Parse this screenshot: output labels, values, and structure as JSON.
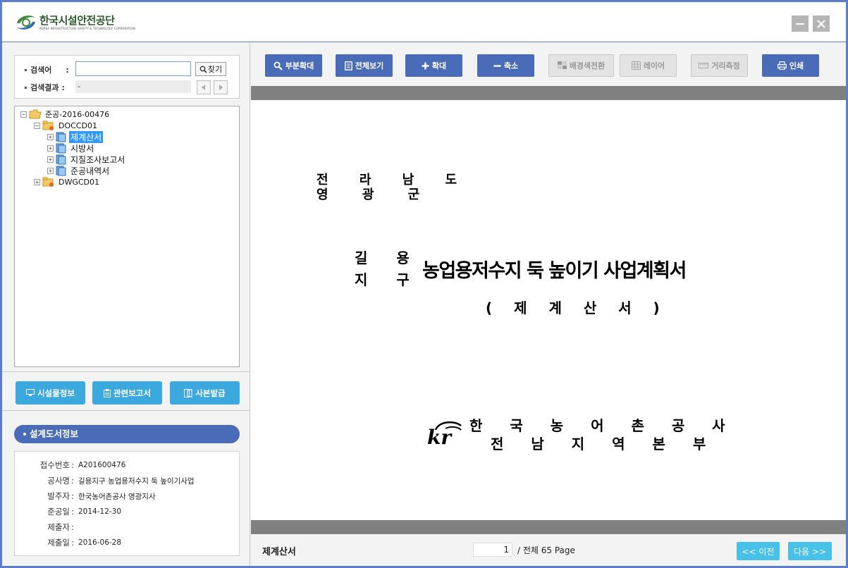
{
  "app": {
    "logo_ko": "한국시설안전공단",
    "logo_en": "KOREA INFRASTRUCTURE SAFETY & TECHNOLOGY CORPORATION"
  },
  "search": {
    "keyword_label": "검색어",
    "keyword_colon": ":",
    "keyword_value": "",
    "find_label": "찾기",
    "result_label": "검색결과",
    "result_colon": ":",
    "result_value": "-"
  },
  "tree": {
    "root": "준공-2016-00476",
    "folder1": "DOCCD01",
    "items": [
      "제계산서",
      "시방서",
      "지질조사보고서",
      "준공내역서"
    ],
    "folder2": "DWGCD01"
  },
  "actions": {
    "facility_info": "시설물정보",
    "related_reports": "관련보고서",
    "copy_issue": "사본발급"
  },
  "info": {
    "header": "설계도서정보",
    "rows": [
      {
        "key": "접수번호",
        "value": "A201600476"
      },
      {
        "key": "공사명",
        "value": "길용지구 농업용저수지 둑 높이기사업"
      },
      {
        "key": "발주자",
        "value": "한국농어촌공사 영광지사"
      },
      {
        "key": "준공일",
        "value": "2014-12-30"
      },
      {
        "key": "제출자",
        "value": ""
      },
      {
        "key": "제출일",
        "value": "2016-06-28"
      }
    ]
  },
  "toolbar": {
    "partial_zoom": "부분확대",
    "full_view": "전체보기",
    "zoom_in": "확대",
    "zoom_out": "축소",
    "bg_toggle": "배경색전환",
    "layer": "레이어",
    "measure": "거리측정",
    "print": "인쇄"
  },
  "document": {
    "region_line1": "전 라 남 도",
    "region_line2": "영 광 군",
    "district_line1": "길 용",
    "district_line2": "지 구",
    "title": "농업용저수지 둑 높이기 사업계획서",
    "subtitle": "( 제 계 산 서 )",
    "org_mark": "kr",
    "org_line1": "한 국 농 어 촌 공 사",
    "org_line2": "전 남 지 역 본 부"
  },
  "footer": {
    "doc_name": "제계산서",
    "current_page": "1",
    "total_label": "/ 전체  65 Page",
    "prev": "<< 이전",
    "next": "다음 >>"
  },
  "colors": {
    "primary_blue": "#4a6cb8",
    "light_blue": "#3ca9de",
    "cyan": "#47c1e8",
    "frame": "#5b7ec9",
    "viewer_bar": "#808080"
  }
}
